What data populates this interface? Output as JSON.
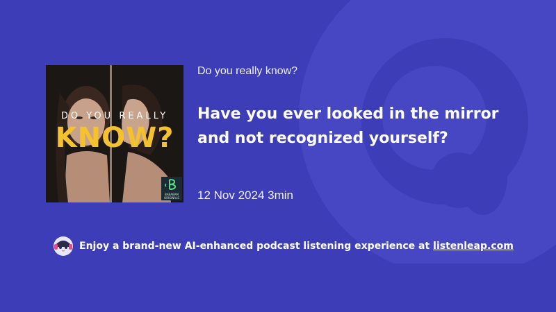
{
  "podcast": {
    "show_title": "Do you really know?",
    "cover": {
      "line1": "DO YOU REALLY",
      "line2": "KNOW?",
      "badge_text": "BABABAM ORIGINALS"
    }
  },
  "episode": {
    "title": "Have you ever looked in the mirror and not recognized yourself?",
    "date": "12 Nov 2024",
    "duration": "3min"
  },
  "footer": {
    "promo_text": "Enjoy a brand-new AI-enhanced podcast listening experience at",
    "link_text": "listenleap.com"
  },
  "colors": {
    "background": "#3d3db8",
    "cover_accent": "#f4c22e"
  },
  "icons": {
    "footer_logo": "listenleap-mascot-icon",
    "background_art": "listenleap-mascot-watermark"
  }
}
